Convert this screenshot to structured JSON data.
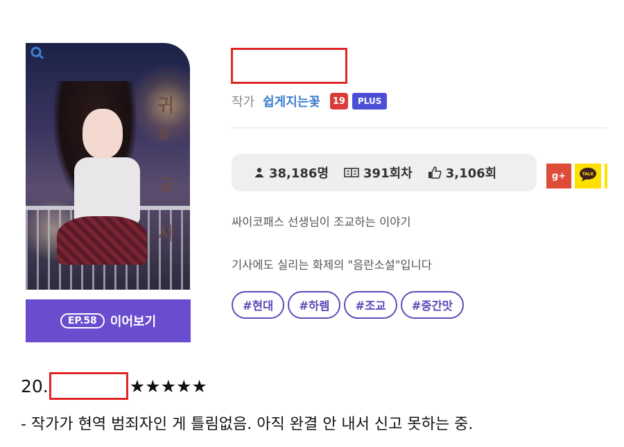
{
  "cover": {
    "title_chars": [
      "귀",
      "흉",
      "교",
      "사"
    ]
  },
  "cta": {
    "episode_badge": "EP.58",
    "label": "이어보기"
  },
  "author": {
    "label": "작가",
    "name": "쉽게지는꽃",
    "age_badge": "19",
    "plus_badge": "PLUS"
  },
  "stats": {
    "readers": "38,186명",
    "episodes": "391회차",
    "likes": "3,106회",
    "icons": [
      "person-icon",
      "book-icon",
      "thumbs-up-icon"
    ]
  },
  "share": {
    "google_plus": "g+",
    "kakao": "TALK"
  },
  "description": [
    "싸이코패스 선생님이 조교하는 이야기",
    "기사에도 실리는 화제의 \"음란소설\"입니다"
  ],
  "tags": [
    "#현대",
    "#하렘",
    "#조교",
    "#중간맛"
  ],
  "rank": {
    "number": "20.",
    "stars": "★★★★★"
  },
  "comment": "- 작가가 현역 범죄자인 게 틀림없음. 아직 완결 안 내서 신고 못하는 중.",
  "colors": {
    "accent": "#6a4ccf",
    "author_blue": "#3a7fcf",
    "redact": "#e02424",
    "age_badge": "#d93a3a",
    "plus_badge": "#4a4fd6"
  }
}
